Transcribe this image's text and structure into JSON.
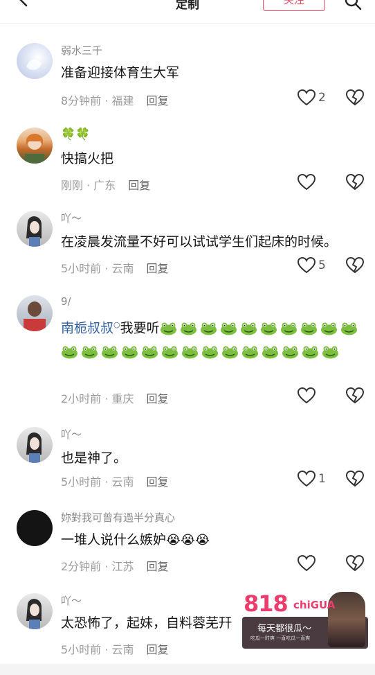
{
  "header": {
    "title": "定制",
    "follow_label": "关注"
  },
  "comments": [
    {
      "username": "弱水三千",
      "text": "准备迎接体育生大军",
      "time": "8分钟前",
      "location": "福建",
      "reply_label": "回复",
      "likes": "2"
    },
    {
      "username": "🍀🍀",
      "text": "快搞火把",
      "time": "刚刚",
      "location": "广东",
      "reply_label": "回复",
      "likes": ""
    },
    {
      "username": "吖～",
      "text": "在凌晨发流量不好可以试试学生们起床的时候。",
      "time": "5小时前",
      "location": "云南",
      "reply_label": "回复",
      "likes": "5"
    },
    {
      "username": "9/",
      "mention": "南栀叔叔",
      "text": "我要听",
      "frog_count": 24,
      "time": "2小时前",
      "location": "重庆",
      "reply_label": "回复",
      "likes": ""
    },
    {
      "username": "吖～",
      "text": "也是神了。",
      "time": "5小时前",
      "location": "云南",
      "reply_label": "回复",
      "likes": "1"
    },
    {
      "username": "妳對我可曾有過半分真心",
      "text": "一堆人说什么嫉妒",
      "emojis": "😭😭😭",
      "time": "2分钟前",
      "location": "江苏",
      "reply_label": "回复",
      "likes": ""
    },
    {
      "username": "吖～",
      "text": "太恐怖了，起妹，自料蓉芜幵",
      "time": "5小时前",
      "location": "云南",
      "reply_label": "回复",
      "likes": ""
    }
  ],
  "ad": {
    "logo": "818",
    "logo_suffix": "chiGUA",
    "line1": "每天都很瓜～",
    "line2": "吃瓜一时爽 一直吃瓜一直爽"
  },
  "colors": {
    "accent": "#ec4d63",
    "mention": "#2f5e9f",
    "meta": "#9b9b9b"
  },
  "icons": {
    "back": "chevron-left-icon",
    "search": "search-icon",
    "like": "heart-outline-icon",
    "dislike": "broken-heart-icon"
  }
}
